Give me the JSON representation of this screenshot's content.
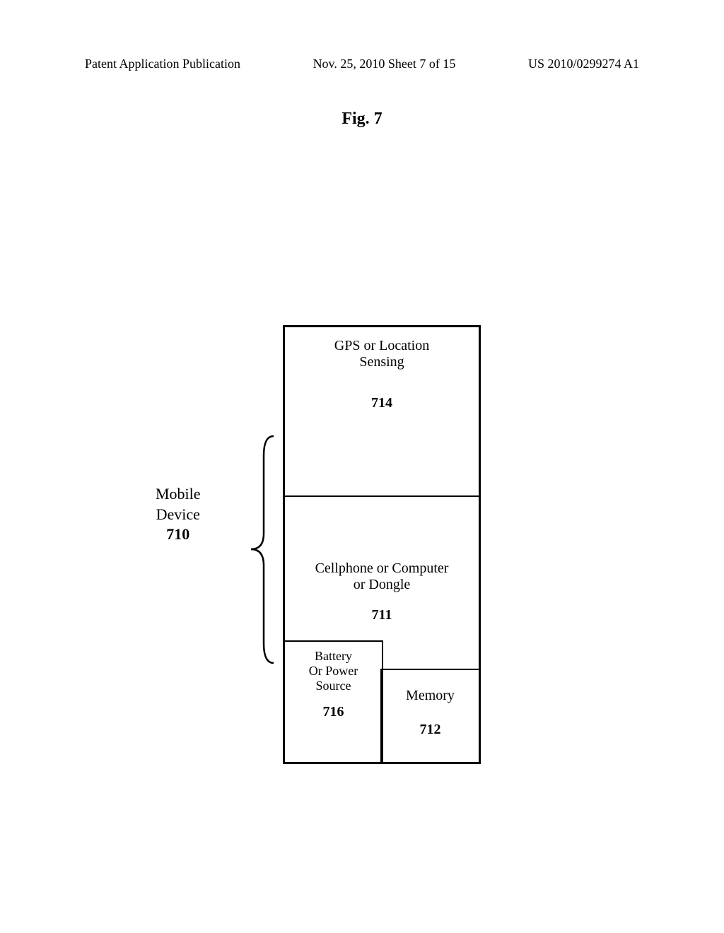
{
  "header": {
    "left": "Patent Application Publication",
    "center": "Nov. 25, 2010  Sheet 7 of 15",
    "right": "US 2010/0299274 A1"
  },
  "figure": {
    "title": "Fig. 7"
  },
  "diagram": {
    "mobile_device": {
      "label_line1": "Mobile",
      "label_line2": "Device",
      "ref": "710"
    },
    "gps": {
      "label_line1": "GPS or Location",
      "label_line2": "Sensing",
      "ref": "714"
    },
    "cellphone": {
      "label_line1": "Cellphone or Computer",
      "label_line2": "or Dongle",
      "ref": "711"
    },
    "battery": {
      "label_line1": "Battery",
      "label_line2": "Or Power",
      "label_line3": "Source",
      "ref": "716"
    },
    "memory": {
      "label": "Memory",
      "ref": "712"
    }
  }
}
